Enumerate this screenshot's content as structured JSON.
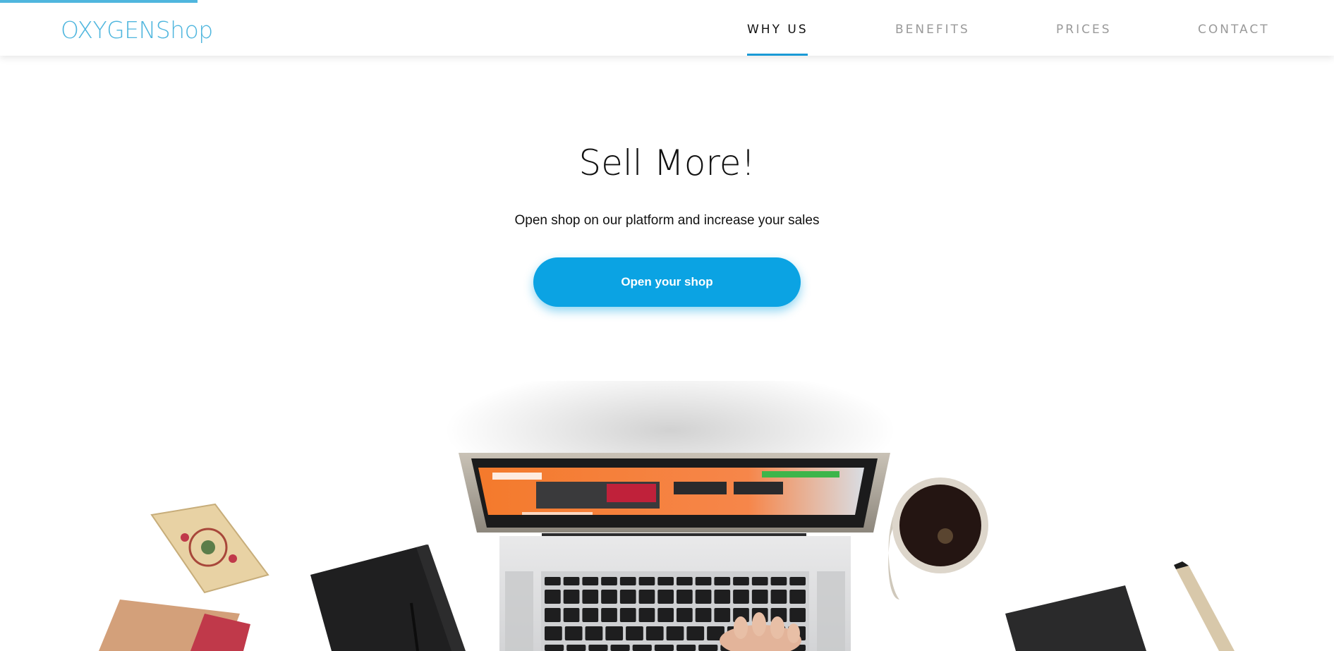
{
  "header": {
    "logo": "OXYGENShop",
    "progress_fraction": 0.148
  },
  "nav": {
    "items": [
      {
        "label": "WHY US",
        "active": true
      },
      {
        "label": "BENEFITS",
        "active": false
      },
      {
        "label": "PRICES",
        "active": false
      },
      {
        "label": "CONTACT",
        "active": false
      }
    ]
  },
  "hero": {
    "title": "Sell More!",
    "subtitle": "Open shop on our platform and increase your sales",
    "cta_label": "Open your shop"
  },
  "colors": {
    "brand": "#4fb6de",
    "cta": "#0ba3e3",
    "nav_active_underline": "#1a9ad6",
    "nav_inactive": "#9a9a9a",
    "screen_accent": "#f47a2c"
  }
}
